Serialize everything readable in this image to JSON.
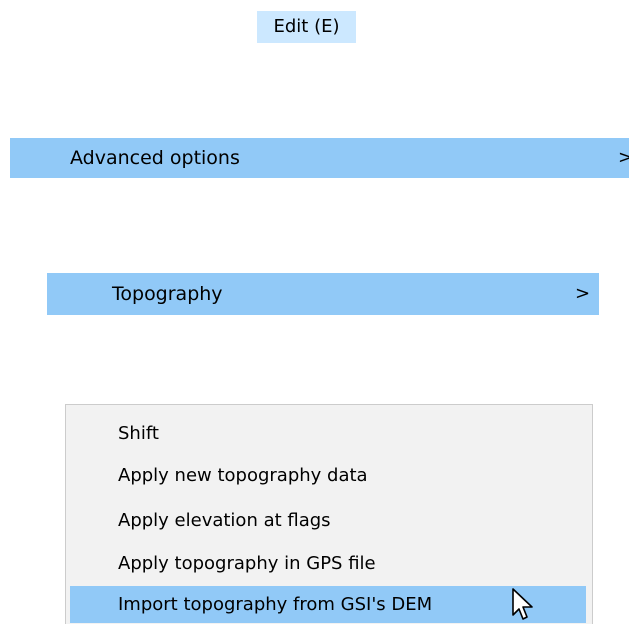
{
  "menubar": {
    "edit_label": "Edit (E)"
  },
  "edit_menu": {
    "advanced_options_label": "Advanced options",
    "advanced_options_arrow": ">"
  },
  "advanced_menu": {
    "topography_label": "Topography",
    "topography_arrow": ">"
  },
  "topography_menu": {
    "items": [
      {
        "label": "Shift"
      },
      {
        "label": "Apply new topography data"
      },
      {
        "label": "Apply elevation at flags"
      },
      {
        "label": "Apply topography in GPS file"
      },
      {
        "label": "Import topography from GSI's DEM",
        "highlighted": true
      }
    ]
  },
  "colors": {
    "menubar_hover": "#cce8ff",
    "menu_highlight": "#91c9f7",
    "menu_background": "#f2f2f2"
  },
  "icons": {
    "pointer": "mouse-pointer-icon"
  }
}
